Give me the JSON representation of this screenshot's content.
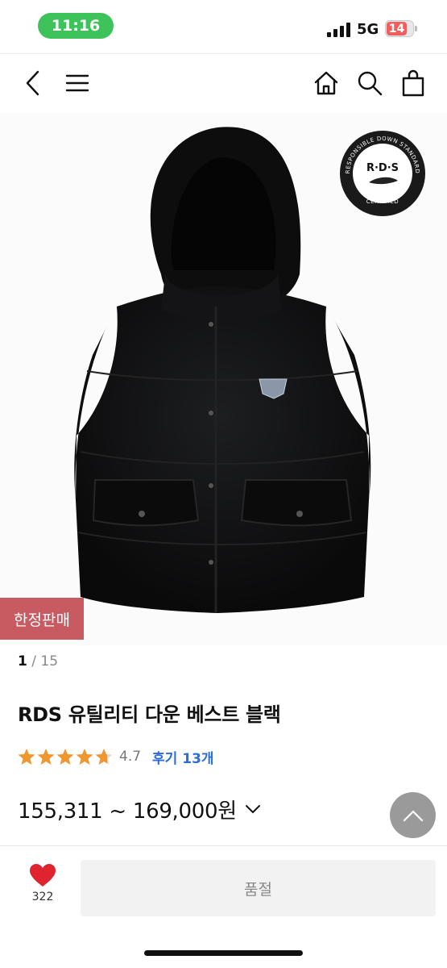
{
  "status_bar": {
    "time": "11:16",
    "network": "5G",
    "battery": "14",
    "battery_color": "#f25e5e",
    "time_pill_color": "#3ec35a"
  },
  "nav": {
    "back_icon": "chevron-left-icon",
    "menu_icon": "hamburger-icon",
    "home_icon": "home-icon",
    "search_icon": "search-icon",
    "cart_icon": "shopping-bag-icon"
  },
  "product": {
    "image_badge_text": "R·D·S",
    "image_badge_ring_text": "RESPONSIBLE DOWN STANDARD",
    "image_badge_bottom_text": "CERTIFIED",
    "limited_badge": "한정판매",
    "limited_badge_color": "#c85a62",
    "pager_current": "1",
    "pager_total": "15",
    "title": "RDS 유틸리티 다운 베스트 블랙",
    "rating": "4.7",
    "stars": 4.7,
    "reviews_label": "후기 13개",
    "price_range": "155,311 ~ 169,000원"
  },
  "actions": {
    "like_count": "322",
    "soldout_label": "품절",
    "heart_color": "#e0242f",
    "accent_link_color": "#2a6ed8"
  }
}
